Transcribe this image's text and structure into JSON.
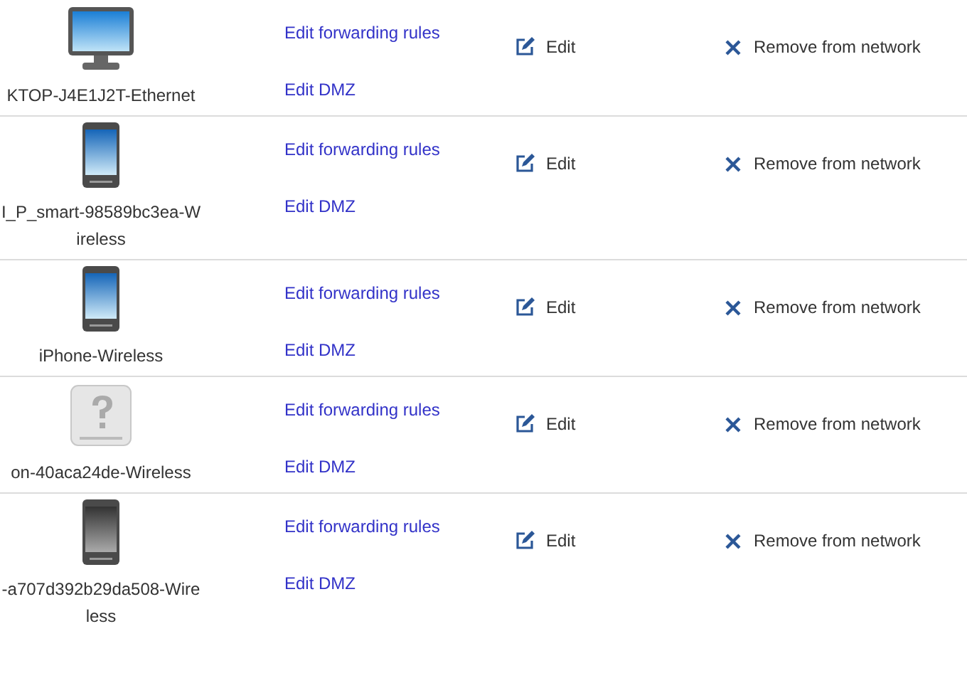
{
  "devices": [
    {
      "kind": "desktop",
      "name": "KTOP-J4E1J2T-Ethernet",
      "links": [
        "Edit forwarding rules",
        "Edit DMZ"
      ],
      "edit": "Edit",
      "remove": "Remove from network"
    },
    {
      "kind": "phone",
      "name": "I_P_smart-98589bc3ea-Wireless",
      "links": [
        "Edit forwarding rules",
        "Edit DMZ"
      ],
      "edit": "Edit",
      "remove": "Remove from network"
    },
    {
      "kind": "phone",
      "name": "iPhone-Wireless",
      "links": [
        "Edit forwarding rules",
        "Edit DMZ"
      ],
      "edit": "Edit",
      "remove": "Remove from network"
    },
    {
      "kind": "unknown",
      "name": "on-40aca24de-Wireless",
      "links": [
        "Edit forwarding rules",
        "Edit DMZ"
      ],
      "edit": "Edit",
      "remove": "Remove from network"
    },
    {
      "kind": "grayphone",
      "name": "-a707d392b29da508-Wireless",
      "links": [
        "Edit forwarding rules",
        "Edit DMZ"
      ],
      "edit": "Edit",
      "remove": "Remove from network"
    }
  ]
}
